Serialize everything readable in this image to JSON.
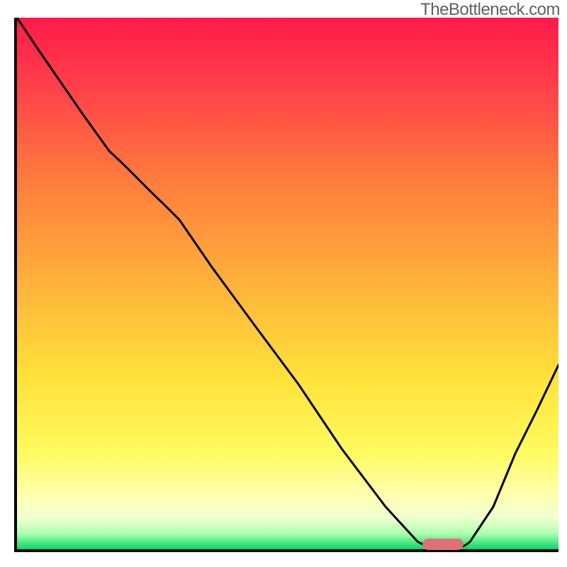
{
  "watermark": "TheBottleneck.com",
  "chart_data": {
    "type": "line",
    "title": "",
    "xlabel": "",
    "ylabel": "",
    "x": [
      0.0,
      0.04,
      0.08,
      0.12,
      0.17,
      0.23,
      0.27,
      0.3,
      0.36,
      0.44,
      0.52,
      0.6,
      0.68,
      0.74,
      0.76,
      0.79,
      0.82,
      0.84,
      0.88,
      0.92,
      0.96,
      1.0
    ],
    "values": [
      1.0,
      0.94,
      0.88,
      0.82,
      0.75,
      0.7,
      0.65,
      0.62,
      0.53,
      0.42,
      0.31,
      0.19,
      0.08,
      0.015,
      0.005,
      0.004,
      0.004,
      0.02,
      0.08,
      0.14,
      0.2,
      0.26
    ],
    "xlim": [
      0,
      1
    ],
    "ylim": [
      0,
      1
    ],
    "gradient_colors": {
      "top": "#ff1a4a",
      "mid_upper": "#ff8c3a",
      "mid": "#ffe23a",
      "mid_lower": "#ffff9a",
      "low": "#c8ffb4",
      "bottom": "#00e676"
    },
    "marker": {
      "x": 0.785,
      "y": 0.003,
      "color": "#df6f78"
    }
  }
}
